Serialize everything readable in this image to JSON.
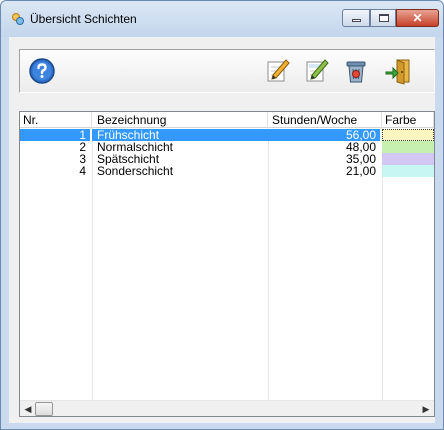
{
  "window": {
    "title": "Übersicht Schichten",
    "close_glyph": "✕"
  },
  "toolbar": {
    "buttons": [
      {
        "name": "help-button",
        "icon": "help-icon"
      },
      {
        "name": "edit-button",
        "icon": "pencil-icon"
      },
      {
        "name": "new-button",
        "icon": "pencil-note-icon"
      },
      {
        "name": "delete-button",
        "icon": "trash-icon"
      },
      {
        "name": "exit-button",
        "icon": "exit-door-icon"
      }
    ]
  },
  "list": {
    "columns": [
      "Nr.",
      "Bezeichnung",
      "Stunden/Woche",
      "Farbe"
    ],
    "rows": [
      {
        "nr": "1",
        "bezeichnung": "Frühschicht",
        "stunden": "56,00",
        "color": "#fff6c0",
        "selected": true
      },
      {
        "nr": "2",
        "bezeichnung": "Normalschicht",
        "stunden": "48,00",
        "color": "#c6f0b0",
        "selected": false
      },
      {
        "nr": "3",
        "bezeichnung": "Spätschicht",
        "stunden": "35,00",
        "color": "#d2c6f2",
        "selected": false
      },
      {
        "nr": "4",
        "bezeichnung": "Sonderschicht",
        "stunden": "21,00",
        "color": "#c8f6f2",
        "selected": false
      }
    ]
  },
  "scrollbar": {
    "left_arrow": "◀",
    "right_arrow": "▶"
  },
  "colors": {
    "selection": "#3399ff",
    "titlebar": "#c3d6ec"
  }
}
